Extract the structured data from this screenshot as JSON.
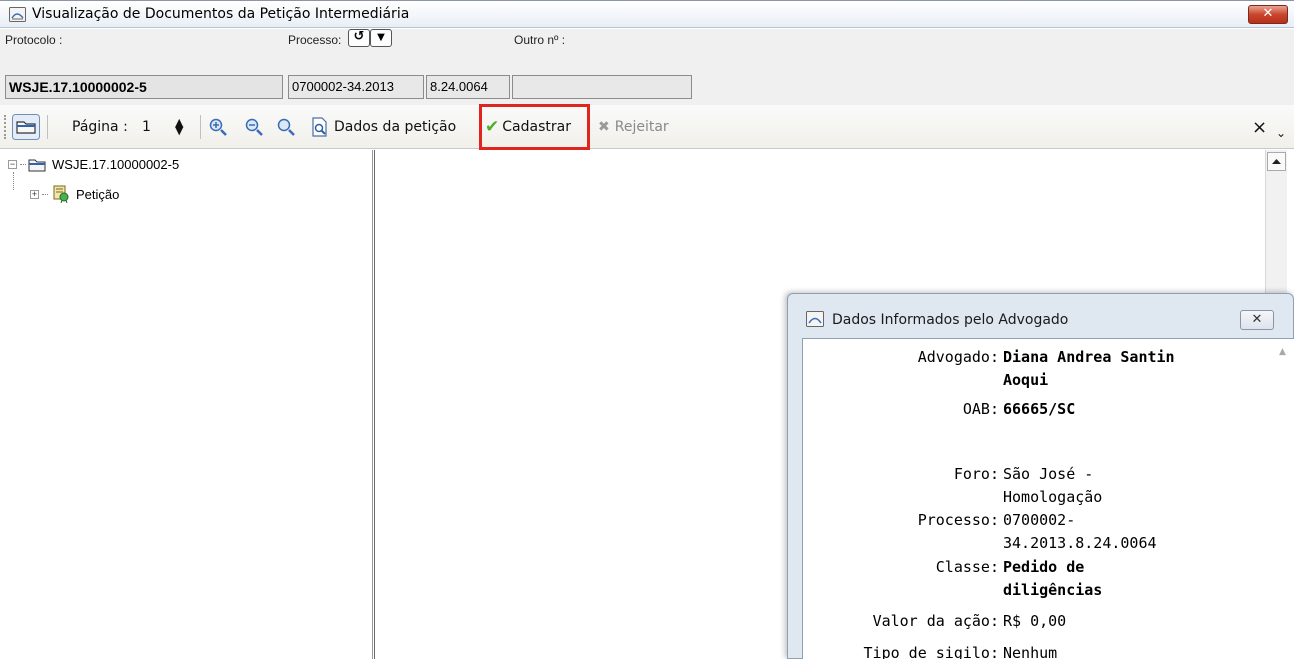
{
  "window": {
    "title": "Visualização de Documentos da Petição Intermediária",
    "close_glyph": "✕"
  },
  "header": {
    "protocolo_label": "Protocolo :",
    "protocolo_value": "WSJE.17.10000002-5",
    "processo_label": "Processo:",
    "processo_part1": "0700002-34.2013",
    "processo_part2": "8.24.0064",
    "processo_part3": "",
    "outro_label": "Outro nº :",
    "outro_value": ""
  },
  "toolbar": {
    "pagina_label": "Página :",
    "pagina_value": "1",
    "dados_peticao_label": "Dados da petição",
    "cadastrar_label": "Cadastrar",
    "rejeitar_label": "Rejeitar",
    "close_glyph": "×",
    "overflow_glyph": "⌄",
    "icons": [
      "folder-icon",
      "spinner-icon",
      "zoom-in-icon",
      "zoom-out-icon",
      "zoom-fit-icon",
      "document-search-icon",
      "check-icon",
      "x-icon"
    ]
  },
  "tree": {
    "root_label": "WSJE.17.10000002-5",
    "child_label": "Petição"
  },
  "dialog": {
    "title": "Dados Informados pelo Advogado",
    "close_glyph": "✕",
    "fields": [
      {
        "key": "Advogado:",
        "value_line1": "Diana Andrea Santin",
        "value_line2": "Aoqui"
      },
      {
        "key": "OAB:",
        "value_line1": "66665/SC",
        "value_line2": ""
      },
      {
        "key": "Foro:",
        "value_line1": "São José -",
        "value_line2": "Homologação"
      },
      {
        "key": "Processo:",
        "value_line1": "0700002-",
        "value_line2": "34.2013.8.24.0064"
      },
      {
        "key": "Classe:",
        "value_line1": "Pedido de",
        "value_line2": "diligências"
      },
      {
        "key": "Valor da ação:",
        "value_line1": "R$ 0,00",
        "value_line2": ""
      },
      {
        "key": "Tipo de sigilo:",
        "value_line1": "Nenhum",
        "value_line2": ""
      }
    ]
  },
  "colors": {
    "highlight": "#e0251f",
    "arrow": "#e0251f",
    "close_button": "#c9452d"
  }
}
